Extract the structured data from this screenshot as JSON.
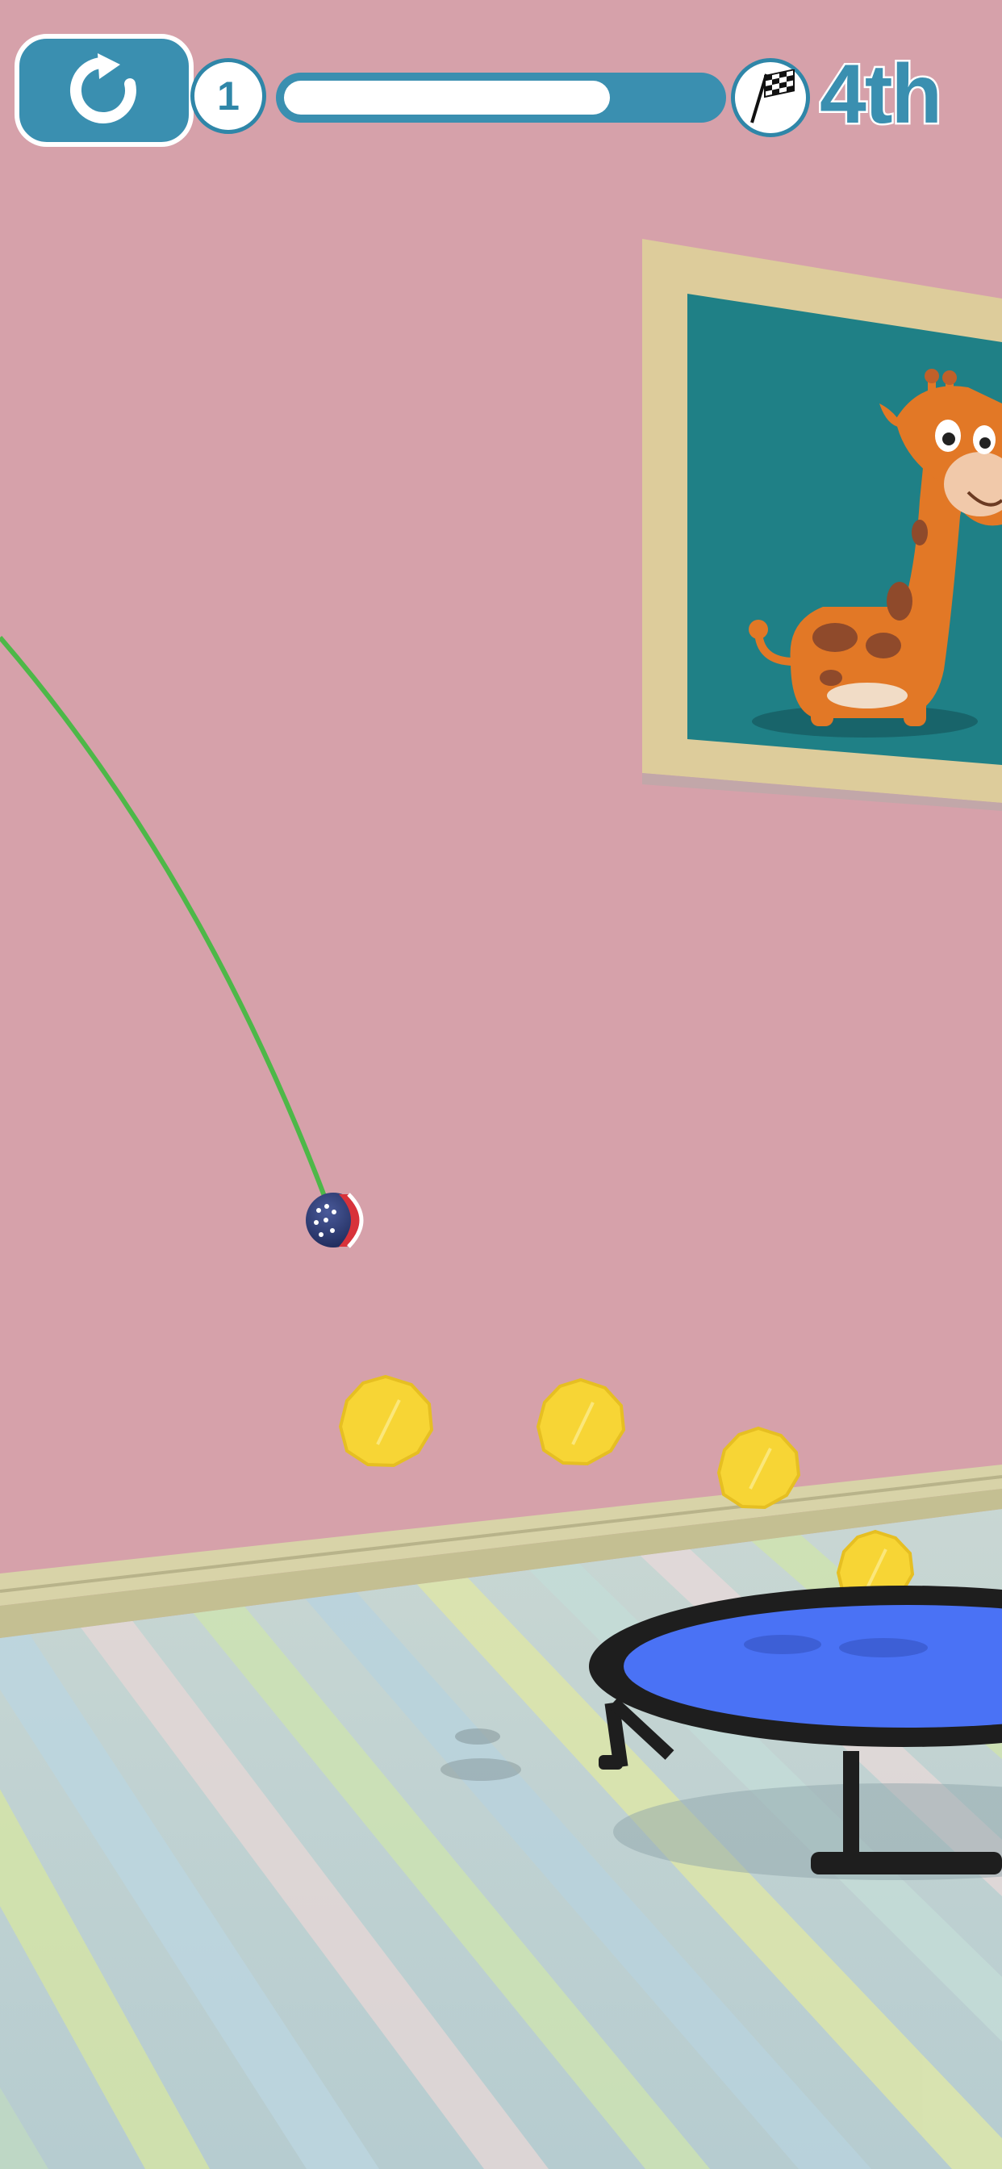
{
  "hud": {
    "restart_icon": "restart-arrow-icon",
    "level_number": "1",
    "progress": 0.75,
    "finish_icon": "checkered-flag-icon",
    "rank": "4th"
  },
  "colors": {
    "wall": "#d6a1aa",
    "hud_blue": "#3a8fb0",
    "rope": "#4db848",
    "coin": "#f7d535",
    "trampoline_mat": "#4a72f5",
    "frame": "#ddcc9b",
    "poster_bg": "#1f8086",
    "giraffe": "#e27826"
  }
}
